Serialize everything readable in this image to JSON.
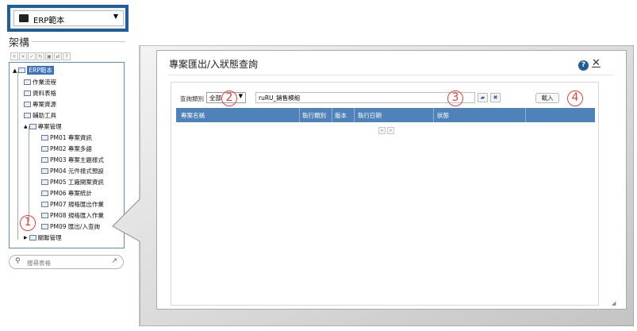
{
  "erp_select": {
    "value": "ERP範本"
  },
  "left_panel": {
    "title": "架構",
    "toolbar_icons": [
      "add-icon",
      "delete-icon",
      "edit-icon",
      "refresh-icon",
      "copy-icon",
      "move-icon",
      "help-icon"
    ],
    "tree": {
      "root": "ERP範本",
      "items": [
        "作業流程",
        "資料表格",
        "專案資源",
        "輔助工具",
        "專案管理"
      ],
      "sub_items": [
        "PM01 專案資訊",
        "PM02 專案多語",
        "PM03 專案主題樣式",
        "PM04 元件樣式預設",
        "PM05 工廠開案資訊",
        "PM06 專案統計",
        "PM07 規格匯出作業",
        "PM08 規格匯入作業",
        "PM09 匯出/入查詢"
      ],
      "last_item": "關聯管理"
    },
    "search_placeholder": "搜尋表格"
  },
  "dialog": {
    "title": "專案匯出/入狀態查詢",
    "query_label": "查詢類別",
    "query_select": "全部",
    "query_value": "ruRU_銷售模組",
    "load_button": "載入",
    "columns": [
      "專案名稱",
      "執行類別",
      "版本",
      "執行日期",
      "狀態"
    ],
    "pager": [
      "«",
      "»"
    ]
  },
  "markers": [
    "1",
    "2",
    "3",
    "4"
  ],
  "colors": {
    "accent": "#1f5e98",
    "header": "#4e82b8",
    "marker": "#e8413a"
  }
}
